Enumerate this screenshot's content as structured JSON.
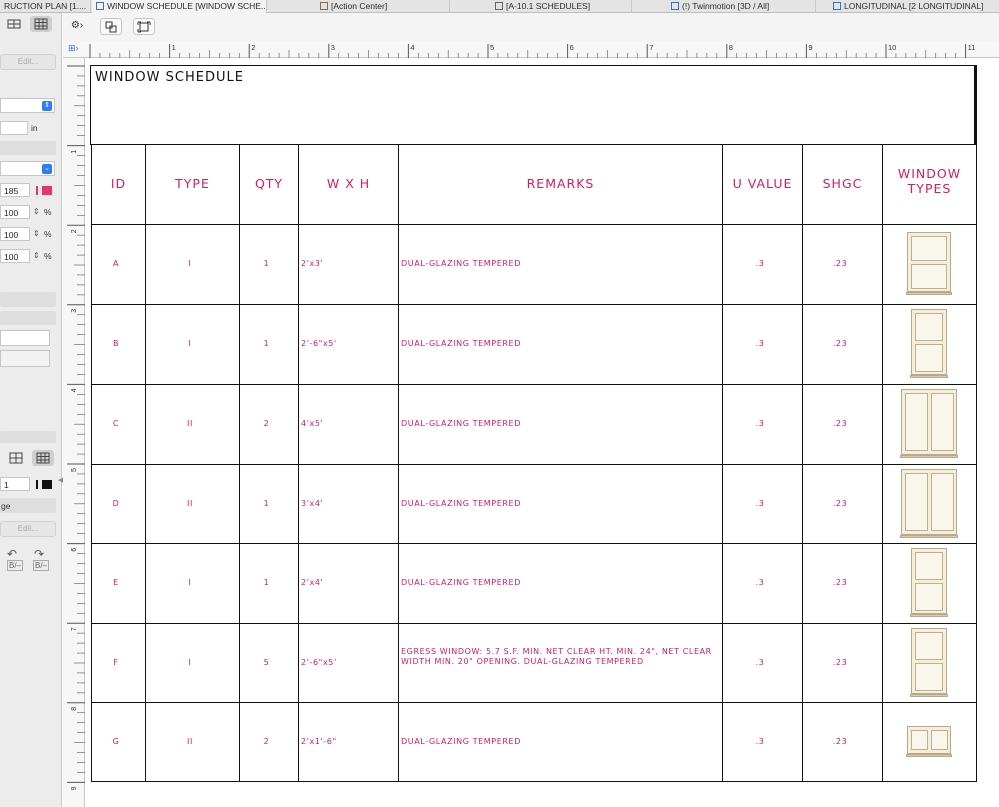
{
  "tabs": [
    {
      "label": "RUCTION PLAN [1...."
    },
    {
      "label": "WINDOW SCHEDULE [WINDOW SCHE..."
    },
    {
      "label": "[Action Center]"
    },
    {
      "label": "[A-10.1 SCHEDULES]"
    },
    {
      "label": "(!) Twinmotion [3D / All]"
    },
    {
      "label": "LONGITUDINAL [2 LONGITUDINAL]"
    }
  ],
  "palette": {
    "edit_label_1": "Edit...",
    "unit": "in",
    "pen_value": "185",
    "pct_1": "100",
    "pct_2": "100",
    "pct_3": "100",
    "pct_sign": "%",
    "line_value": "1",
    "truncated_label": "ge",
    "edit_label_2": "Edit...",
    "undo_label": "B/–",
    "redo_label": "B/–",
    "accent_color": "#e8336c"
  },
  "ruler": {
    "h_numbers": [
      "1",
      "2",
      "3",
      "4",
      "5",
      "6",
      "7",
      "8",
      "9",
      "10",
      "11"
    ],
    "v_numbers": [
      "1",
      "2",
      "3",
      "4",
      "5",
      "6",
      "7",
      "8",
      "9"
    ]
  },
  "schedule": {
    "title": "WINDOW SCHEDULE",
    "text_color": "#d81b60",
    "headers": {
      "id": "ID",
      "type": "TYPE",
      "qty": "QTY",
      "wxh": "W X H",
      "remarks": "REMARKS",
      "u_value": "U VALUE",
      "shgc": "SHGC",
      "window_types": "WINDOW TYPES"
    },
    "rows": [
      {
        "id": "A",
        "type": "I",
        "qty": "1",
        "wxh": "2'x3'",
        "remarks": "DUAL-GLAZING TEMPERED",
        "u": ".3",
        "shgc": ".23",
        "icon": "single-hung-window-icon"
      },
      {
        "id": "B",
        "type": "I",
        "qty": "1",
        "wxh": "2'-6\"x5'",
        "remarks": "DUAL-GLAZING TEMPERED",
        "u": ".3",
        "shgc": ".23",
        "icon": "single-hung-window-icon"
      },
      {
        "id": "C",
        "type": "II",
        "qty": "2",
        "wxh": "4'x5'",
        "remarks": "DUAL-GLAZING TEMPERED",
        "u": ".3",
        "shgc": ".23",
        "icon": "double-casement-window-icon"
      },
      {
        "id": "D",
        "type": "II",
        "qty": "1",
        "wxh": "3'x4'",
        "remarks": "DUAL-GLAZING TEMPERED",
        "u": ".3",
        "shgc": ".23",
        "icon": "double-casement-window-icon"
      },
      {
        "id": "E",
        "type": "I",
        "qty": "1",
        "wxh": "2'x4'",
        "remarks": "DUAL-GLAZING TEMPERED",
        "u": ".3",
        "shgc": ".23",
        "icon": "single-hung-window-icon"
      },
      {
        "id": "F",
        "type": "I",
        "qty": "5",
        "wxh": "2'-6\"x5'",
        "remarks": "EGRESS WINDOW: 5.7 S.F. MIN. NET CLEAR HT. MIN. 24\", NET CLEAR WIDTH MIN. 20\" OPENING. DUAL-GLAZING TEMPERED",
        "u": ".3",
        "shgc": ".23",
        "icon": "single-hung-window-icon"
      },
      {
        "id": "G",
        "type": "II",
        "qty": "2",
        "wxh": "2'x1'-6\"",
        "remarks": "DUAL-GLAZING TEMPERED",
        "u": ".3",
        "shgc": ".23",
        "icon": "double-casement-window-icon"
      }
    ]
  }
}
